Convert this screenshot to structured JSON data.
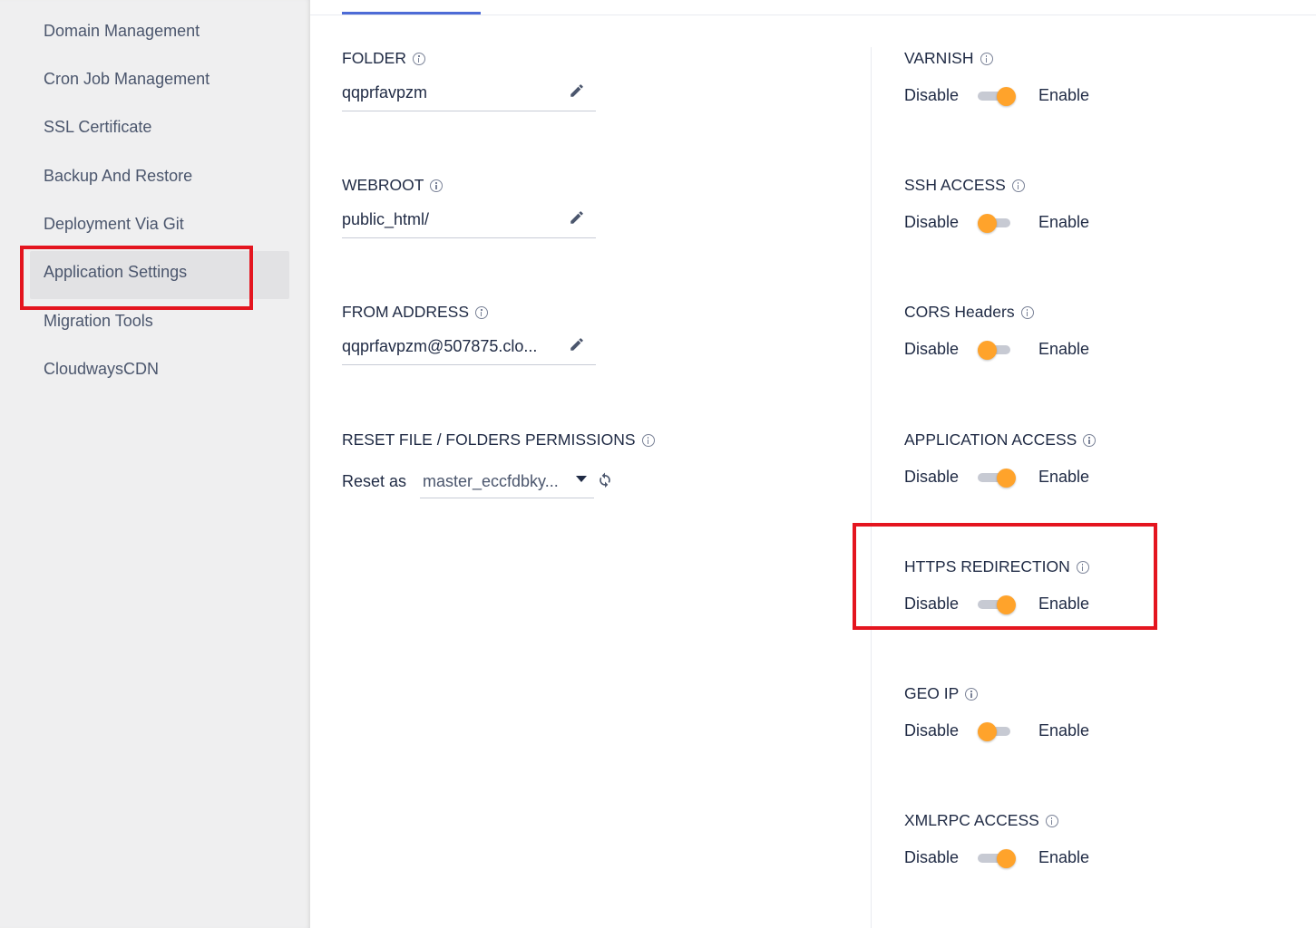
{
  "sidebar": {
    "items": [
      {
        "label": "Domain Management"
      },
      {
        "label": "Cron Job Management"
      },
      {
        "label": "SSL Certificate"
      },
      {
        "label": "Backup And Restore"
      },
      {
        "label": "Deployment Via Git"
      },
      {
        "label": "Application Settings",
        "active": true
      },
      {
        "label": "Migration Tools"
      },
      {
        "label": "CloudwaysCDN"
      }
    ]
  },
  "settings": {
    "folder": {
      "label": "FOLDER",
      "value": "qqprfavpzm"
    },
    "webroot": {
      "label": "WEBROOT",
      "value": "public_html/"
    },
    "from_address": {
      "label": "FROM ADDRESS",
      "value": "qqprfavpzm@507875.clo..."
    },
    "reset_permissions": {
      "label": "RESET FILE / FOLDERS PERMISSIONS",
      "reset_as_label": "Reset as",
      "selected_user": "master_eccfdbky..."
    }
  },
  "toggles": {
    "disable_label": "Disable",
    "enable_label": "Enable",
    "varnish": {
      "label": "VARNISH",
      "enabled": true
    },
    "ssh_access": {
      "label": "SSH ACCESS",
      "enabled": false
    },
    "cors_headers": {
      "label": "CORS Headers",
      "enabled": false
    },
    "application_access": {
      "label": "APPLICATION ACCESS",
      "enabled": true
    },
    "https_redirection": {
      "label": "HTTPS REDIRECTION",
      "enabled": true
    },
    "geo_ip": {
      "label": "GEO IP",
      "enabled": false
    },
    "xmlrpc_access": {
      "label": "XMLRPC ACCESS",
      "enabled": true
    }
  },
  "colors": {
    "highlight": "#e4151f",
    "toggle_knob": "#ffa32b",
    "toggle_track": "#c7cad3",
    "tab_indicator": "#4d6bd6"
  }
}
